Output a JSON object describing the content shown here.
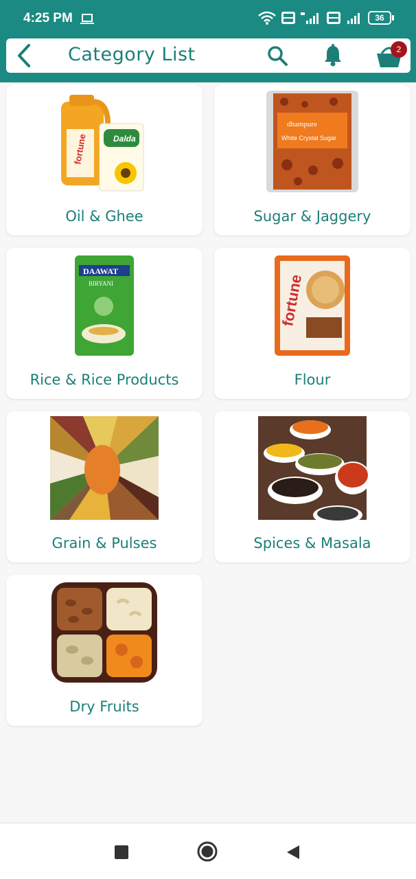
{
  "status_bar": {
    "time": "4:25 PM",
    "battery": "36"
  },
  "header": {
    "title": "Category List",
    "cart_count": "2"
  },
  "categories": [
    {
      "label": "Oil & Ghee"
    },
    {
      "label": "Sugar & Jaggery"
    },
    {
      "label": "Rice & Rice Products"
    },
    {
      "label": "Flour"
    },
    {
      "label": "Grain & Pulses"
    },
    {
      "label": "Spices & Masala"
    },
    {
      "label": "Dry Fruits"
    }
  ],
  "colors": {
    "primary": "#1b8a82",
    "title_text": "#1b7f78",
    "badge": "#a3151e"
  },
  "icons": {
    "back": "chevron-left-icon",
    "search": "search-icon",
    "notifications": "bell-icon",
    "cart": "cart-icon"
  }
}
